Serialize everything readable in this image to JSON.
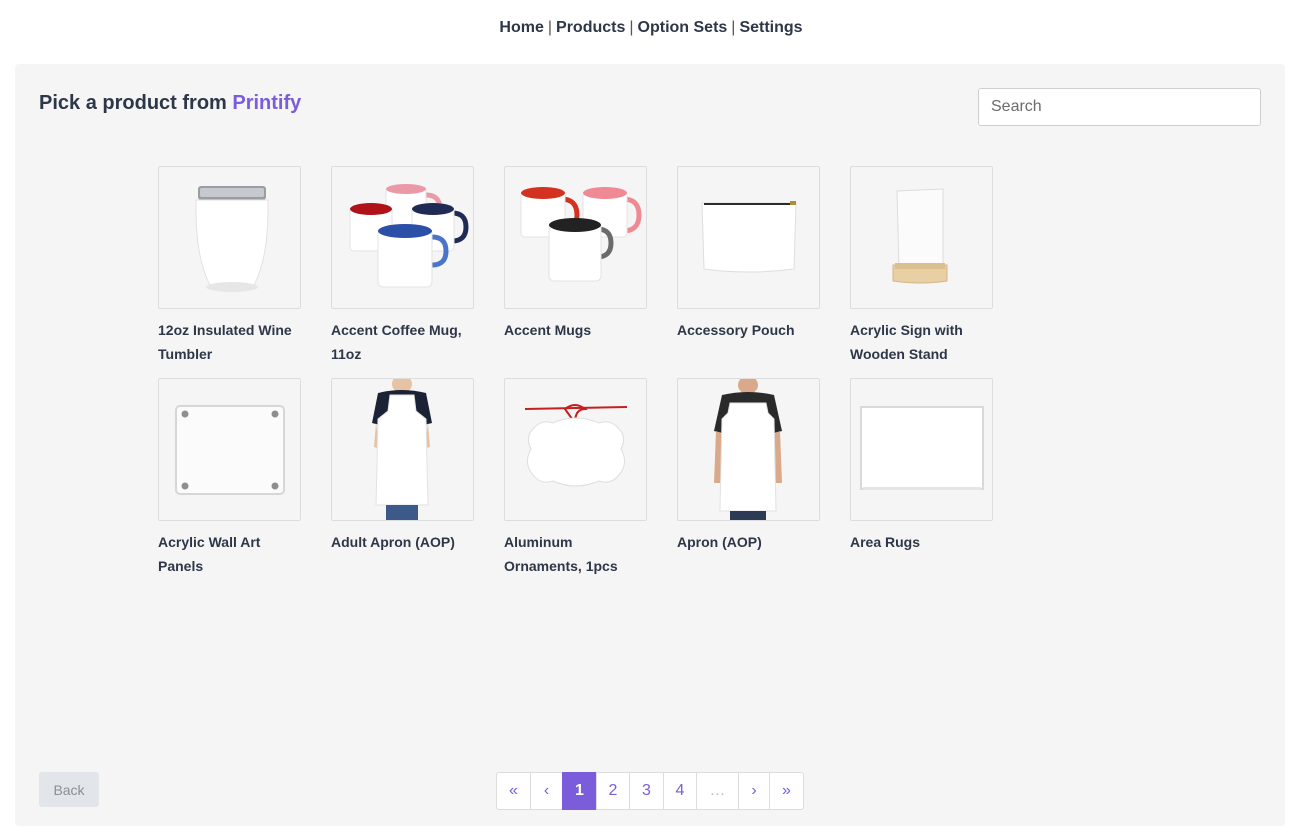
{
  "nav": {
    "home": "Home",
    "products": "Products",
    "option_sets": "Option Sets",
    "settings": "Settings",
    "separator": "|"
  },
  "header": {
    "title_prefix": "Pick a product from",
    "brand": "Printify"
  },
  "search": {
    "placeholder": "Search",
    "value": ""
  },
  "products": [
    {
      "name": "12oz Insulated Wine Tumbler",
      "icon": "wine-tumbler-image"
    },
    {
      "name": "Accent Coffee Mug, 11oz",
      "icon": "accent-coffee-mug-image"
    },
    {
      "name": "Accent Mugs",
      "icon": "accent-mugs-image"
    },
    {
      "name": "Accessory Pouch",
      "icon": "accessory-pouch-image"
    },
    {
      "name": "Acrylic Sign with Wooden Stand",
      "icon": "acrylic-sign-image"
    },
    {
      "name": "Acrylic Wall Art Panels",
      "icon": "acrylic-panel-image"
    },
    {
      "name": "Adult Apron (AOP)",
      "icon": "adult-apron-image"
    },
    {
      "name": "Aluminum Ornaments, 1pcs",
      "icon": "ornament-image"
    },
    {
      "name": "Apron (AOP)",
      "icon": "apron-image"
    },
    {
      "name": "Area Rugs",
      "icon": "area-rug-image"
    }
  ],
  "footer": {
    "back_label": "Back"
  },
  "pagination": {
    "first": "«",
    "prev": "‹",
    "pages": [
      "1",
      "2",
      "3",
      "4"
    ],
    "current": "1",
    "ellipsis": "…",
    "next": "›",
    "last": "»"
  },
  "colors": {
    "accent": "#7b5cdb",
    "text": "#2d3748",
    "panel_bg": "#f5f5f5"
  }
}
